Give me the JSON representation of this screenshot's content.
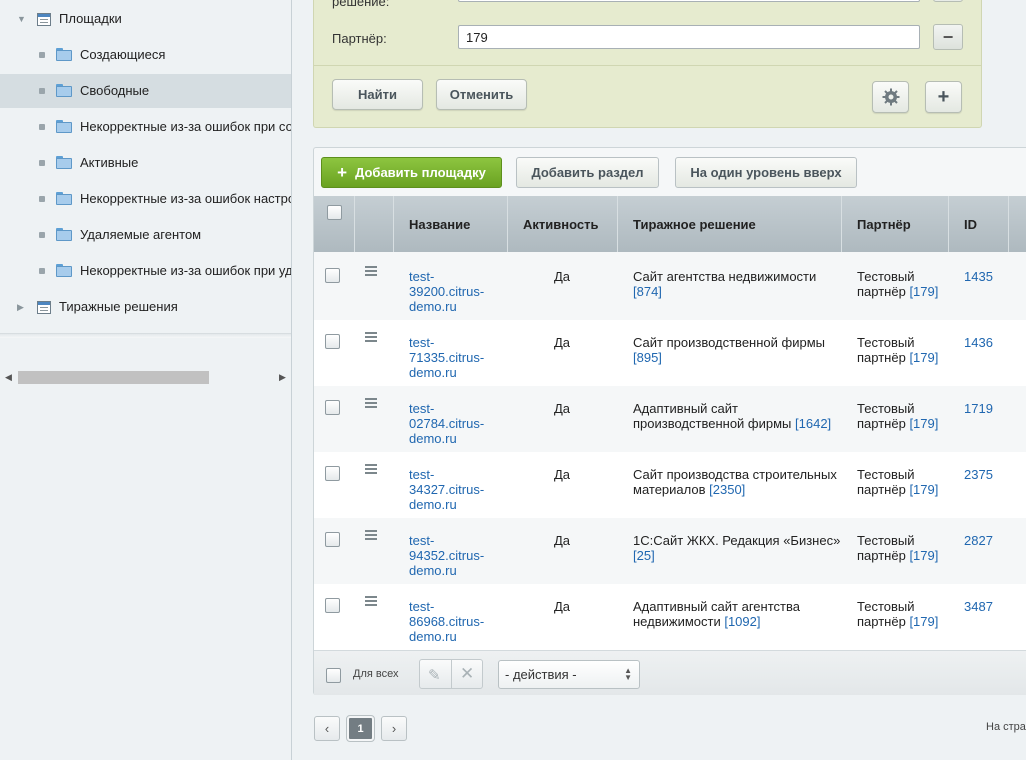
{
  "sidebar": {
    "items": [
      {
        "label": "Площадки",
        "type": "root-open"
      },
      {
        "label": "Создающиеся",
        "type": "child"
      },
      {
        "label": "Свободные",
        "type": "child",
        "selected": true
      },
      {
        "label": "Некорректные из-за ошибок при со",
        "type": "child"
      },
      {
        "label": "Активные",
        "type": "child"
      },
      {
        "label": "Некорректные из-за ошибок настро",
        "type": "child"
      },
      {
        "label": "Удаляемые агентом",
        "type": "child"
      },
      {
        "label": "Некорректные из-за ошибок при уд",
        "type": "child"
      },
      {
        "label": "Тиражные решения",
        "type": "root-closed"
      }
    ]
  },
  "filter": {
    "cut_label": "решение:",
    "partner_label": "Партнёр:",
    "partner_value": "179",
    "find_label": "Найти",
    "cancel_label": "Отменить"
  },
  "toolbar": {
    "add_site_label": "Добавить площадку",
    "add_section_label": "Добавить раздел",
    "level_up_label": "На один уровень вверх"
  },
  "grid": {
    "columns": [
      "Название",
      "Активность",
      "Тиражное решение",
      "Партнёр",
      "ID"
    ],
    "rows": [
      {
        "name": "test-39200.citrus-demo.ru",
        "active": "Да",
        "solution": "Сайт агентства недвижимости",
        "solution_id": "[874]",
        "partner": "Тестовый партнёр",
        "partner_id": "[179]",
        "id": "1435"
      },
      {
        "name": "test-71335.citrus-demo.ru",
        "active": "Да",
        "solution": "Сайт производственной фирмы",
        "solution_id": "[895]",
        "partner": "Тестовый партнёр",
        "partner_id": "[179]",
        "id": "1436"
      },
      {
        "name": "test-02784.citrus-demo.ru",
        "active": "Да",
        "solution": "Адаптивный сайт производственной фирмы",
        "solution_id": "[1642]",
        "partner": "Тестовый партнёр",
        "partner_id": "[179]",
        "id": "1719"
      },
      {
        "name": "test-34327.citrus-demo.ru",
        "active": "Да",
        "solution": "Сайт производства строительных материалов",
        "solution_id": "[2350]",
        "partner": "Тестовый партнёр",
        "partner_id": "[179]",
        "id": "2375"
      },
      {
        "name": "test-94352.citrus-demo.ru",
        "active": "Да",
        "solution": "1С:Сайт ЖКХ. Редакция «Бизнес»",
        "solution_id": "[25]",
        "partner": "Тестовый партнёр",
        "partner_id": "[179]",
        "id": "2827"
      },
      {
        "name": "test-86968.citrus-demo.ru",
        "active": "Да",
        "solution": "Адаптивный сайт агентства недвижимости",
        "solution_id": "[1092]",
        "partner": "Тестовый партнёр",
        "partner_id": "[179]",
        "id": "3487"
      }
    ],
    "footer": {
      "for_all_label": "Для всех",
      "actions_value": "- действия -"
    }
  },
  "pagination": {
    "prev": "‹",
    "current": "1",
    "next": "›",
    "per_page_label": "На стра"
  }
}
